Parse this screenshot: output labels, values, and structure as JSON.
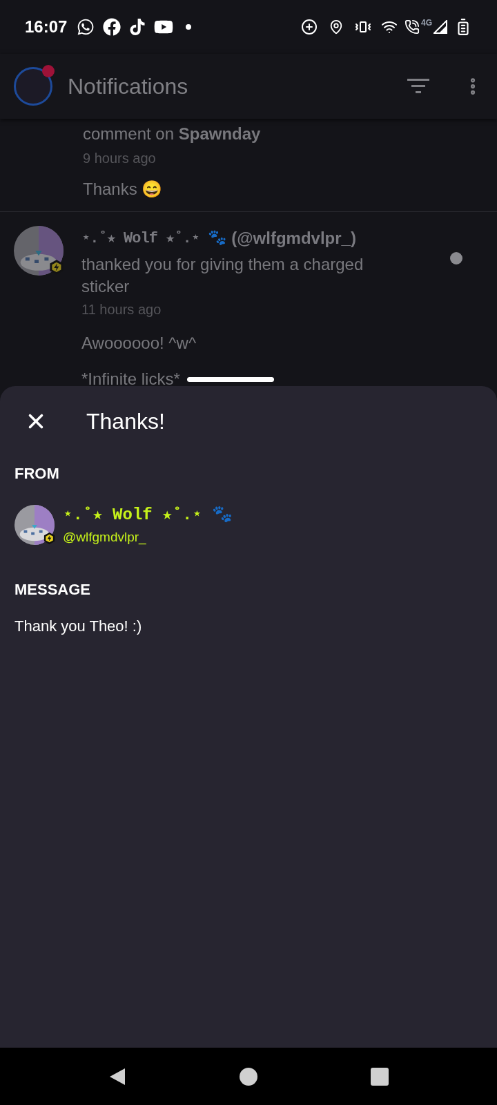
{
  "status_bar": {
    "time": "16:07",
    "network": "4G"
  },
  "app_bar": {
    "title": "Notifications",
    "avatar_badge": true
  },
  "notifications": [
    {
      "text": "comment on **Spawnday**",
      "time": "9 hours ago",
      "messages": [
        "Thanks 😄"
      ],
      "unread": false
    },
    {
      "name": "⋆.˚★ Wolf ★˚.⋆ 🐾",
      "handle": "(@wlfgmdvlpr_)",
      "text": "thanked you for giving them a charged sticker",
      "time": "11 hours ago",
      "messages": [
        "Awoooooo! ^w^",
        "*Infinite licks*"
      ],
      "unread": true
    }
  ],
  "sheet": {
    "title": "Thanks!",
    "from_label": "FROM",
    "sender": {
      "name": "⋆.˚★ Wolf ★˚.⋆ 🐾",
      "handle": "@wlfgmdvlpr_"
    },
    "message_label": "MESSAGE",
    "message": "Thank you Theo! :)"
  }
}
